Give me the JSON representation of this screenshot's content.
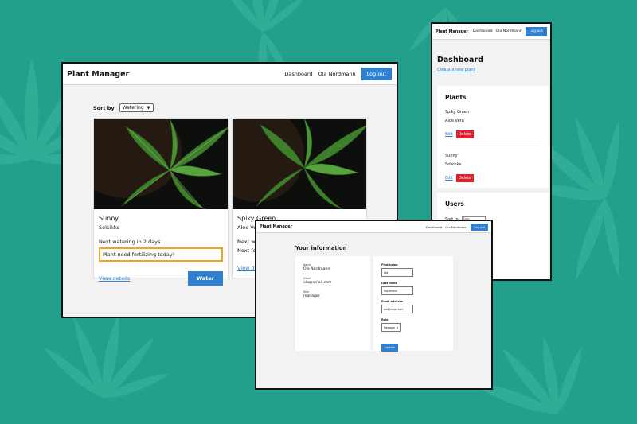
{
  "colors": {
    "background": "#23a08c",
    "accent": "#2f80d1",
    "danger": "#e0202c",
    "notice_border": "#f0a51c"
  },
  "main_window": {
    "brand": "Plant Manager",
    "nav": {
      "dashboard": "Dashboard",
      "user": "Ola Nordmann",
      "logout": "Log out"
    },
    "sort": {
      "label": "Sort by",
      "value": "Watering"
    },
    "cards": [
      {
        "name": "Sunny",
        "subtitle": "Solsikke",
        "next_watering": "Next watering in 2 days",
        "notice": "Plant need fertilizing today!",
        "details": "View details",
        "action": "Water"
      },
      {
        "name": "Spiky Green",
        "subtitle": "Aloe Vera",
        "next_watering": "Next wate",
        "notice": "Next fert",
        "details": "View deta"
      }
    ]
  },
  "dashboard_window": {
    "brand": "Plant Manager",
    "nav": {
      "dashboard": "Dashboard",
      "user": "Ola Nordmann",
      "logout": "Log out"
    },
    "title": "Dashboard",
    "create_link": "Create a new plant",
    "plants_title": "Plants",
    "plants": [
      {
        "name": "Spiky Green",
        "subtitle": "Aloe Vera",
        "edit": "Edit",
        "delete": "Delete"
      },
      {
        "name": "Sunny",
        "subtitle": "Solsikke",
        "edit": "Edit",
        "delete": "Delete"
      }
    ],
    "users_title": "Users",
    "users_sort_label": "Sort by",
    "users_sort_value": "Role"
  },
  "info_window": {
    "brand": "Plant Manager",
    "nav": {
      "dashboard": "Dashboard",
      "user": "Ola Nordmann",
      "logout": "Log out"
    },
    "title": "Your information",
    "info": [
      {
        "label": "Name",
        "value": "Ola Nordmann"
      },
      {
        "label": "Email",
        "value": "ola@email.com"
      },
      {
        "label": "Role",
        "value": "manager"
      }
    ],
    "form": {
      "first_name_label": "First name",
      "first_name_value": "Ola",
      "last_name_label": "Last name",
      "last_name_value": "Nordmann",
      "email_label": "Email address",
      "email_value": "ola@email.com",
      "role_label": "Role",
      "role_value": "Manager",
      "update": "Update"
    }
  }
}
